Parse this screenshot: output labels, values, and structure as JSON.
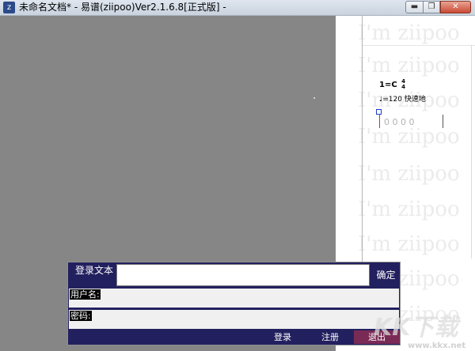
{
  "window": {
    "title": "未命名文档* - 易谱(ziipoo)Ver2.1.6.8[正式版]  -",
    "icon_glyph": "z",
    "minimize_glyph": "▬",
    "maximize_glyph": "❐",
    "close_glyph": "✕"
  },
  "score": {
    "key": "1=C",
    "time_top": "4",
    "time_bottom": "4",
    "tempo_note": "♩",
    "tempo_text": "=120  快速地",
    "notes": "0  0  0  0",
    "watermark_text": "I'm ziipoo"
  },
  "login": {
    "login_text_label": "登录文本",
    "login_text_value": "",
    "ok_button": "确定",
    "username_label": "用户名:",
    "username_value": "",
    "password_label": "密码:",
    "password_value": "",
    "login_button": "登录",
    "register_button": "注册",
    "exit_button": "退出"
  },
  "overlay": {
    "logo_text": "KK下载",
    "url_text": "www.kkx.net"
  },
  "colors": {
    "canvas_gray": "#868686",
    "login_panel": "#23205f",
    "exit_button": "#7a2b55",
    "cursor": "#e0302a"
  }
}
